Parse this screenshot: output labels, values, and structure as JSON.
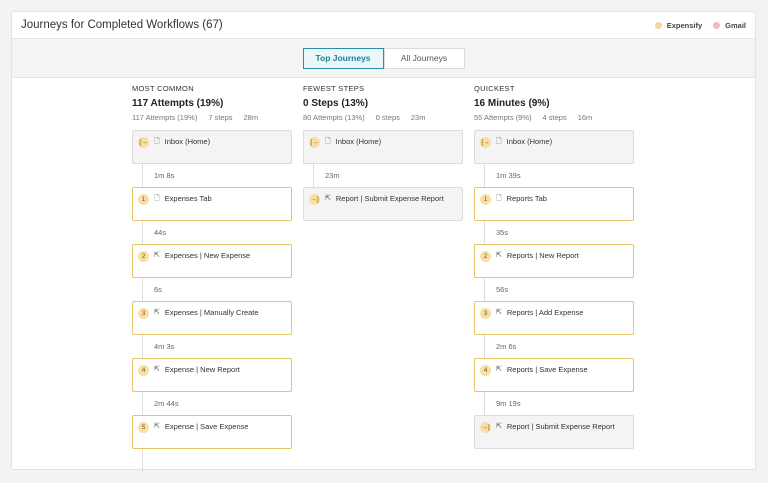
{
  "header": {
    "title": "Journeys for Completed Workflows (67)",
    "legend": [
      {
        "label": "Expensify",
        "color": "#f5d79a"
      },
      {
        "label": "Gmail",
        "color": "#f5b8be"
      }
    ]
  },
  "tabs": [
    {
      "label": "Top Journeys",
      "active": true
    },
    {
      "label": "All Journeys",
      "active": false
    }
  ],
  "columns": [
    {
      "kicker": "MOST COMMON",
      "title": "117 Attempts (19%)",
      "meta": [
        "117 Attempts (19%)",
        "7 steps",
        "28m"
      ],
      "steps": [
        {
          "badge": "[→",
          "icon": "page",
          "label": "Inbox (Home)",
          "kind": "start"
        },
        {
          "badge": "1",
          "icon": "page",
          "label": "Expenses Tab",
          "gap": "1m 8s"
        },
        {
          "badge": "2",
          "icon": "click",
          "label": "Expenses | New Expense",
          "gap": "44s"
        },
        {
          "badge": "3",
          "icon": "click",
          "label": "Expenses | Manually Create",
          "gap": "6s"
        },
        {
          "badge": "4",
          "icon": "click",
          "label": "Expense | New Report",
          "gap": "4m 3s"
        },
        {
          "badge": "5",
          "icon": "click",
          "label": "Expense | Save Expense",
          "gap": "2m 44s"
        }
      ]
    },
    {
      "kicker": "FEWEST STEPS",
      "title": "0 Steps (13%)",
      "meta": [
        "80 Attempts (13%)",
        "0 steps",
        "23m"
      ],
      "steps": [
        {
          "badge": "[→",
          "icon": "page",
          "label": "Inbox (Home)",
          "kind": "start"
        },
        {
          "badge": "→]",
          "icon": "click",
          "label": "Report | Submit Expense Report",
          "gap": "23m",
          "kind": "end"
        }
      ]
    },
    {
      "kicker": "QUICKEST",
      "title": "16 Minutes  (9%)",
      "meta": [
        "55 Attempts (9%)",
        "4 steps",
        "16m"
      ],
      "steps": [
        {
          "badge": "[→",
          "icon": "page",
          "label": "Inbox (Home)",
          "kind": "start"
        },
        {
          "badge": "1",
          "icon": "page",
          "label": "Reports Tab",
          "gap": "1m 39s"
        },
        {
          "badge": "2",
          "icon": "click",
          "label": "Reports | New Report",
          "gap": "35s"
        },
        {
          "badge": "3",
          "icon": "click",
          "label": "Reports | Add Expense",
          "gap": "56s"
        },
        {
          "badge": "4",
          "icon": "click",
          "label": "Reports | Save Expense",
          "gap": "2m 6s"
        },
        {
          "badge": "→]",
          "icon": "click",
          "label": "Report | Submit Expense Report",
          "gap": "9m 19s",
          "kind": "end"
        }
      ]
    }
  ]
}
